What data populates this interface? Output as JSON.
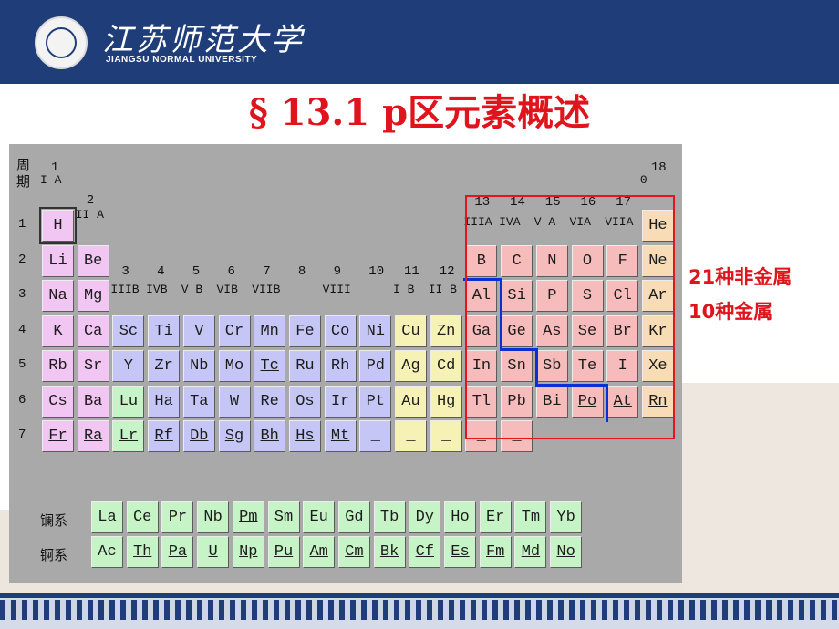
{
  "header": {
    "school_cn": "江苏师范大学",
    "school_en": "JIANGSU NORMAL UNIVERSITY"
  },
  "title": "§ 13.1  p区元素概述",
  "period_label": "周期",
  "period_label_2": "期",
  "group_labels": [
    {
      "num": "1",
      "name": "I A"
    },
    {
      "num": "2",
      "name": "II A"
    },
    {
      "num": "3",
      "name": "IIIB"
    },
    {
      "num": "4",
      "name": "IVB"
    },
    {
      "num": "5",
      "name": "V B"
    },
    {
      "num": "6",
      "name": "VIB"
    },
    {
      "num": "7",
      "name": "VIIB"
    },
    {
      "num": "8",
      "name": ""
    },
    {
      "num": "9",
      "name": "VIII"
    },
    {
      "num": "10",
      "name": ""
    },
    {
      "num": "11",
      "name": "I B"
    },
    {
      "num": "12",
      "name": "II B"
    },
    {
      "num": "13",
      "name": "IIIA"
    },
    {
      "num": "14",
      "name": "IVA"
    },
    {
      "num": "15",
      "name": "V A"
    },
    {
      "num": "16",
      "name": "VIA"
    },
    {
      "num": "17",
      "name": "VIIA"
    },
    {
      "num": "18",
      "name": "0"
    }
  ],
  "periods": [
    "1",
    "2",
    "3",
    "4",
    "5",
    "6",
    "7"
  ],
  "colors": {
    "s_block": "#f2c6f2",
    "d_block": "#c6c6f6",
    "ds_block": "#f6f2b6",
    "p_block": "#f6bcbc",
    "noble": "#f7dcb6",
    "f_block": "#c6f4c6",
    "accent_red": "#e0141c",
    "boundary_blue": "#0b2fd6",
    "header_blue": "#1f3e79"
  },
  "table": [
    {
      "s": "H",
      "p": 1,
      "g": 1,
      "c": "s_block"
    },
    {
      "s": "He",
      "p": 1,
      "g": 18,
      "c": "noble"
    },
    {
      "s": "Li",
      "p": 2,
      "g": 1,
      "c": "s_block"
    },
    {
      "s": "Be",
      "p": 2,
      "g": 2,
      "c": "s_block"
    },
    {
      "s": "B",
      "p": 2,
      "g": 13,
      "c": "p_block"
    },
    {
      "s": "C",
      "p": 2,
      "g": 14,
      "c": "p_block"
    },
    {
      "s": "N",
      "p": 2,
      "g": 15,
      "c": "p_block"
    },
    {
      "s": "O",
      "p": 2,
      "g": 16,
      "c": "p_block"
    },
    {
      "s": "F",
      "p": 2,
      "g": 17,
      "c": "p_block"
    },
    {
      "s": "Ne",
      "p": 2,
      "g": 18,
      "c": "noble"
    },
    {
      "s": "Na",
      "p": 3,
      "g": 1,
      "c": "s_block"
    },
    {
      "s": "Mg",
      "p": 3,
      "g": 2,
      "c": "s_block"
    },
    {
      "s": "Al",
      "p": 3,
      "g": 13,
      "c": "p_block"
    },
    {
      "s": "Si",
      "p": 3,
      "g": 14,
      "c": "p_block"
    },
    {
      "s": "P",
      "p": 3,
      "g": 15,
      "c": "p_block"
    },
    {
      "s": "S",
      "p": 3,
      "g": 16,
      "c": "p_block"
    },
    {
      "s": "Cl",
      "p": 3,
      "g": 17,
      "c": "p_block"
    },
    {
      "s": "Ar",
      "p": 3,
      "g": 18,
      "c": "noble"
    },
    {
      "s": "K",
      "p": 4,
      "g": 1,
      "c": "s_block"
    },
    {
      "s": "Ca",
      "p": 4,
      "g": 2,
      "c": "s_block"
    },
    {
      "s": "Sc",
      "p": 4,
      "g": 3,
      "c": "d_block"
    },
    {
      "s": "Ti",
      "p": 4,
      "g": 4,
      "c": "d_block"
    },
    {
      "s": "V",
      "p": 4,
      "g": 5,
      "c": "d_block"
    },
    {
      "s": "Cr",
      "p": 4,
      "g": 6,
      "c": "d_block"
    },
    {
      "s": "Mn",
      "p": 4,
      "g": 7,
      "c": "d_block"
    },
    {
      "s": "Fe",
      "p": 4,
      "g": 8,
      "c": "d_block"
    },
    {
      "s": "Co",
      "p": 4,
      "g": 9,
      "c": "d_block"
    },
    {
      "s": "Ni",
      "p": 4,
      "g": 10,
      "c": "d_block"
    },
    {
      "s": "Cu",
      "p": 4,
      "g": 11,
      "c": "ds_block"
    },
    {
      "s": "Zn",
      "p": 4,
      "g": 12,
      "c": "ds_block"
    },
    {
      "s": "Ga",
      "p": 4,
      "g": 13,
      "c": "p_block"
    },
    {
      "s": "Ge",
      "p": 4,
      "g": 14,
      "c": "p_block"
    },
    {
      "s": "As",
      "p": 4,
      "g": 15,
      "c": "p_block"
    },
    {
      "s": "Se",
      "p": 4,
      "g": 16,
      "c": "p_block"
    },
    {
      "s": "Br",
      "p": 4,
      "g": 17,
      "c": "p_block"
    },
    {
      "s": "Kr",
      "p": 4,
      "g": 18,
      "c": "noble"
    },
    {
      "s": "Rb",
      "p": 5,
      "g": 1,
      "c": "s_block"
    },
    {
      "s": "Sr",
      "p": 5,
      "g": 2,
      "c": "s_block"
    },
    {
      "s": "Y",
      "p": 5,
      "g": 3,
      "c": "d_block"
    },
    {
      "s": "Zr",
      "p": 5,
      "g": 4,
      "c": "d_block"
    },
    {
      "s": "Nb",
      "p": 5,
      "g": 5,
      "c": "d_block"
    },
    {
      "s": "Mo",
      "p": 5,
      "g": 6,
      "c": "d_block"
    },
    {
      "s": "Tc",
      "p": 5,
      "g": 7,
      "c": "d_block",
      "u": true
    },
    {
      "s": "Ru",
      "p": 5,
      "g": 8,
      "c": "d_block"
    },
    {
      "s": "Rh",
      "p": 5,
      "g": 9,
      "c": "d_block"
    },
    {
      "s": "Pd",
      "p": 5,
      "g": 10,
      "c": "d_block"
    },
    {
      "s": "Ag",
      "p": 5,
      "g": 11,
      "c": "ds_block"
    },
    {
      "s": "Cd",
      "p": 5,
      "g": 12,
      "c": "ds_block"
    },
    {
      "s": "In",
      "p": 5,
      "g": 13,
      "c": "p_block"
    },
    {
      "s": "Sn",
      "p": 5,
      "g": 14,
      "c": "p_block"
    },
    {
      "s": "Sb",
      "p": 5,
      "g": 15,
      "c": "p_block"
    },
    {
      "s": "Te",
      "p": 5,
      "g": 16,
      "c": "p_block"
    },
    {
      "s": "I",
      "p": 5,
      "g": 17,
      "c": "p_block"
    },
    {
      "s": "Xe",
      "p": 5,
      "g": 18,
      "c": "noble"
    },
    {
      "s": "Cs",
      "p": 6,
      "g": 1,
      "c": "s_block"
    },
    {
      "s": "Ba",
      "p": 6,
      "g": 2,
      "c": "s_block"
    },
    {
      "s": "Lu",
      "p": 6,
      "g": 3,
      "c": "f_block"
    },
    {
      "s": "Ha",
      "p": 6,
      "g": 4,
      "c": "d_block"
    },
    {
      "s": "Ta",
      "p": 6,
      "g": 5,
      "c": "d_block"
    },
    {
      "s": "W",
      "p": 6,
      "g": 6,
      "c": "d_block"
    },
    {
      "s": "Re",
      "p": 6,
      "g": 7,
      "c": "d_block"
    },
    {
      "s": "Os",
      "p": 6,
      "g": 8,
      "c": "d_block"
    },
    {
      "s": "Ir",
      "p": 6,
      "g": 9,
      "c": "d_block"
    },
    {
      "s": "Pt",
      "p": 6,
      "g": 10,
      "c": "d_block"
    },
    {
      "s": "Au",
      "p": 6,
      "g": 11,
      "c": "ds_block"
    },
    {
      "s": "Hg",
      "p": 6,
      "g": 12,
      "c": "ds_block"
    },
    {
      "s": "Tl",
      "p": 6,
      "g": 13,
      "c": "p_block"
    },
    {
      "s": "Pb",
      "p": 6,
      "g": 14,
      "c": "p_block"
    },
    {
      "s": "Bi",
      "p": 6,
      "g": 15,
      "c": "p_block"
    },
    {
      "s": "Po",
      "p": 6,
      "g": 16,
      "c": "p_block",
      "u": true
    },
    {
      "s": "At",
      "p": 6,
      "g": 17,
      "c": "p_block",
      "u": true
    },
    {
      "s": "Rn",
      "p": 6,
      "g": 18,
      "c": "noble",
      "u": true
    },
    {
      "s": "Fr",
      "p": 7,
      "g": 1,
      "c": "s_block",
      "u": true
    },
    {
      "s": "Ra",
      "p": 7,
      "g": 2,
      "c": "s_block",
      "u": true
    },
    {
      "s": "Lr",
      "p": 7,
      "g": 3,
      "c": "f_block",
      "u": true
    },
    {
      "s": "Rf",
      "p": 7,
      "g": 4,
      "c": "d_block",
      "u": true
    },
    {
      "s": "Db",
      "p": 7,
      "g": 5,
      "c": "d_block",
      "u": true
    },
    {
      "s": "Sg",
      "p": 7,
      "g": 6,
      "c": "d_block",
      "u": true
    },
    {
      "s": "Bh",
      "p": 7,
      "g": 7,
      "c": "d_block",
      "u": true
    },
    {
      "s": "Hs",
      "p": 7,
      "g": 8,
      "c": "d_block",
      "u": true
    },
    {
      "s": "Mt",
      "p": 7,
      "g": 9,
      "c": "d_block",
      "u": true
    },
    {
      "s": "_",
      "p": 7,
      "g": 10,
      "c": "d_block"
    },
    {
      "s": "_",
      "p": 7,
      "g": 11,
      "c": "ds_block"
    },
    {
      "s": "_",
      "p": 7,
      "g": 12,
      "c": "ds_block"
    },
    {
      "s": "_",
      "p": 7,
      "g": 13,
      "c": "p_block"
    },
    {
      "s": "_",
      "p": 7,
      "g": 14,
      "c": "p_block"
    }
  ],
  "lanthanide_label": "镧系",
  "actinide_label": "锕系",
  "lanthanides": [
    {
      "s": "La"
    },
    {
      "s": "Ce"
    },
    {
      "s": "Pr"
    },
    {
      "s": "Nb"
    },
    {
      "s": "Pm",
      "u": true
    },
    {
      "s": "Sm"
    },
    {
      "s": "Eu"
    },
    {
      "s": "Gd"
    },
    {
      "s": "Tb"
    },
    {
      "s": "Dy"
    },
    {
      "s": "Ho"
    },
    {
      "s": "Er"
    },
    {
      "s": "Tm"
    },
    {
      "s": "Yb"
    }
  ],
  "actinides": [
    {
      "s": "Ac"
    },
    {
      "s": "Th",
      "u": true
    },
    {
      "s": "Pa",
      "u": true
    },
    {
      "s": "U",
      "u": true
    },
    {
      "s": "Np",
      "u": true
    },
    {
      "s": "Pu",
      "u": true
    },
    {
      "s": "Am",
      "u": true
    },
    {
      "s": "Cm",
      "u": true
    },
    {
      "s": "Bk",
      "u": true
    },
    {
      "s": "Cf",
      "u": true
    },
    {
      "s": "Es",
      "u": true
    },
    {
      "s": "Fm",
      "u": true
    },
    {
      "s": "Md",
      "u": true
    },
    {
      "s": "No",
      "u": true
    }
  ],
  "notes": {
    "nonmetals": "21种非金属",
    "metals": "10种金属"
  }
}
